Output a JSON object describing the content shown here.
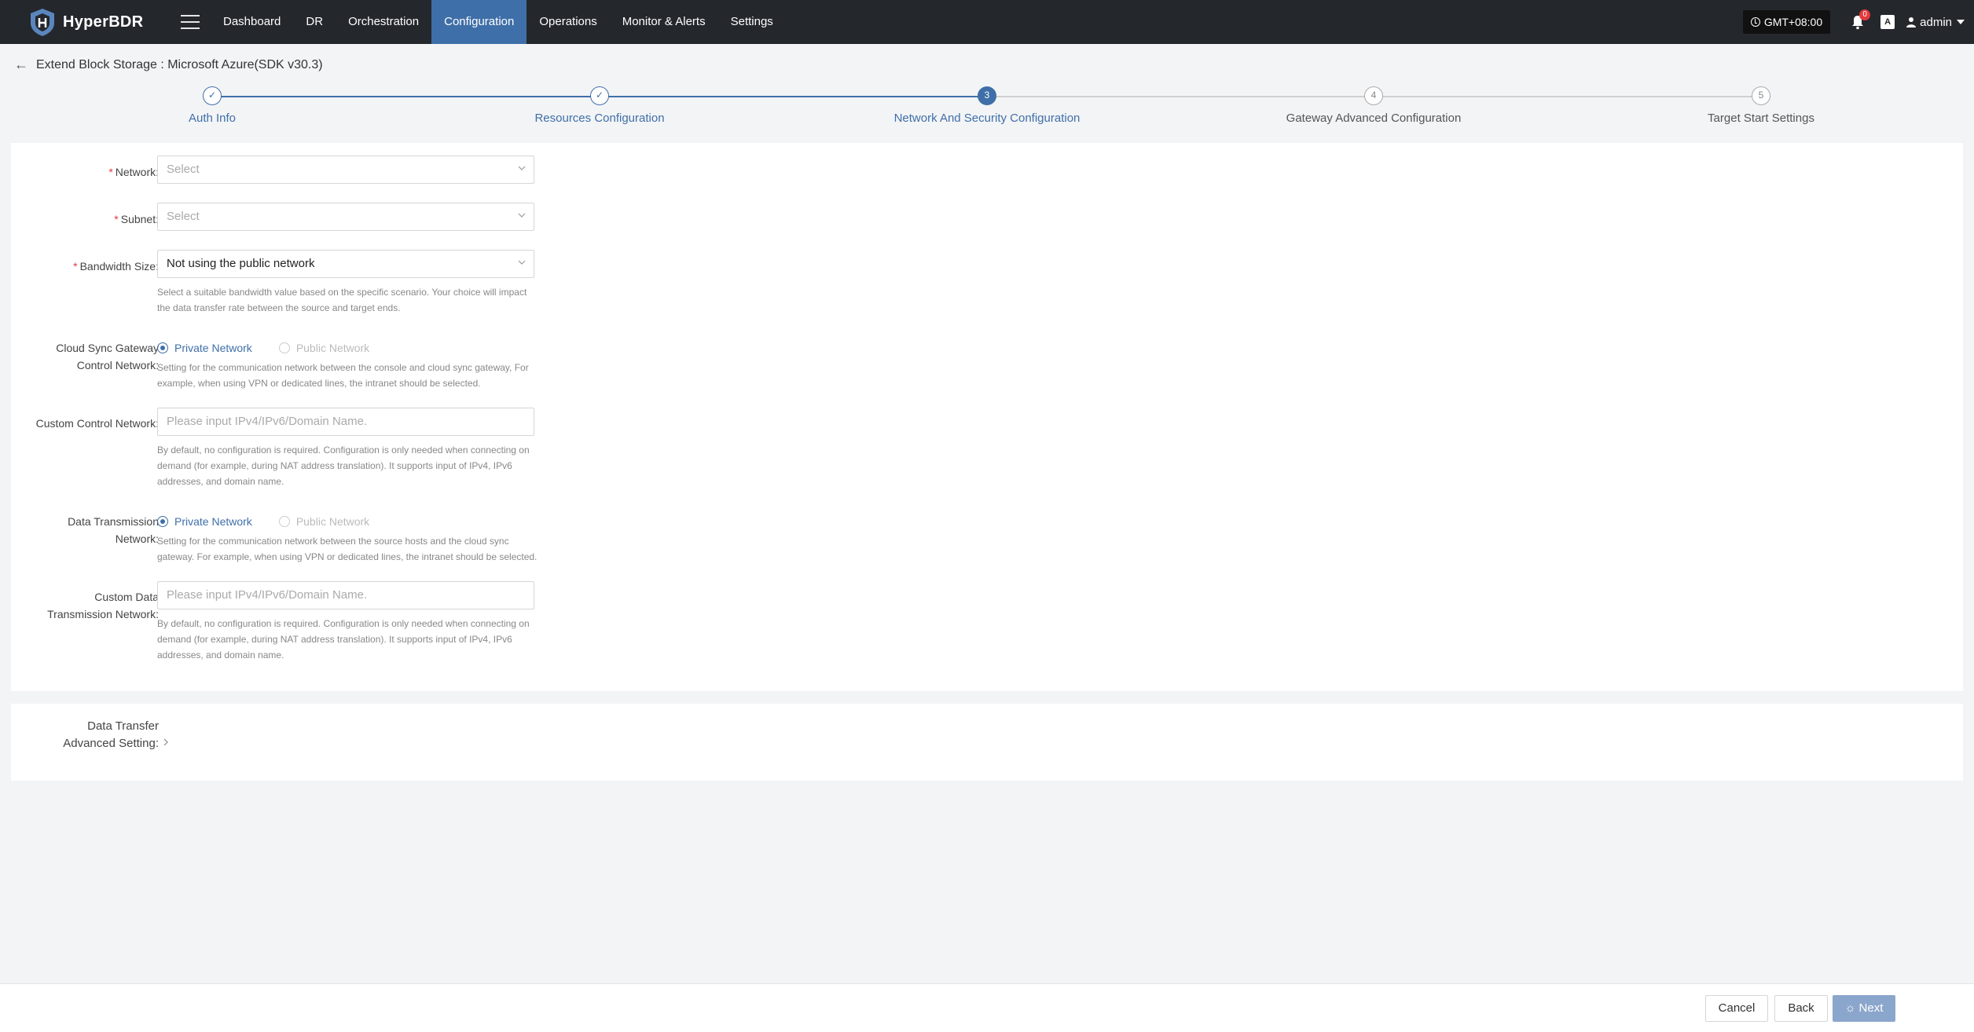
{
  "app": {
    "name": "HyperBDR"
  },
  "nav": {
    "items": [
      "Dashboard",
      "DR",
      "Orchestration",
      "Configuration",
      "Operations",
      "Monitor & Alerts",
      "Settings"
    ],
    "active": "Configuration"
  },
  "topright": {
    "timezone": "GMT+08:00",
    "notifications": "0",
    "lang": "A",
    "user": "admin"
  },
  "page": {
    "title": "Extend Block Storage : Microsoft Azure(SDK v30.3)"
  },
  "steps": [
    {
      "num": "1",
      "label": "Auth Info",
      "state": "done"
    },
    {
      "num": "2",
      "label": "Resources Configuration",
      "state": "done"
    },
    {
      "num": "3",
      "label": "Network And Security Configuration",
      "state": "active"
    },
    {
      "num": "4",
      "label": "Gateway Advanced Configuration",
      "state": "pending"
    },
    {
      "num": "5",
      "label": "Target Start Settings",
      "state": "pending"
    }
  ],
  "form": {
    "network": {
      "label": "Network:",
      "placeholder": "Select"
    },
    "subnet": {
      "label": "Subnet:",
      "placeholder": "Select"
    },
    "bandwidth": {
      "label": "Bandwidth Size:",
      "value": "Not using the public network",
      "help1": "Select a suitable bandwidth value based on the specific scenario. Your choice will impact",
      "help2": "the data transfer rate between the source and target ends."
    },
    "control_network": {
      "label1": "Cloud Sync Gateway",
      "label2": "Control Network:",
      "option_private": "Private Network",
      "option_public": "Public Network",
      "help1": "Setting for the communication network between the console and cloud sync gateway, For",
      "help2": "example, when using VPN or dedicated lines, the intranet should be selected."
    },
    "custom_control": {
      "label": "Custom Control Network:",
      "placeholder": "Please input IPv4/IPv6/Domain Name.",
      "help1": "By default, no configuration is required. Configuration is only needed when connecting on",
      "help2": "demand (for example, during NAT address translation). It supports input of IPv4, IPv6",
      "help3": "addresses, and domain name."
    },
    "data_network": {
      "label1": "Data Transmission",
      "label2": "Network:",
      "option_private": "Private Network",
      "option_public": "Public Network",
      "help1": "Setting for the communication network between the source hosts and the cloud sync",
      "help2": "gateway. For example, when using VPN or dedicated lines, the intranet should be selected."
    },
    "custom_data": {
      "label1": "Custom Data",
      "label2": "Transmission Network:",
      "placeholder": "Please input IPv4/IPv6/Domain Name.",
      "help1": "By default, no configuration is required. Configuration is only needed when connecting on",
      "help2": "demand (for example, during NAT address translation). It supports input of IPv4, IPv6",
      "help3": "addresses, and domain name."
    }
  },
  "advanced": {
    "label1": "Data Transfer",
    "label2": "Advanced Setting:"
  },
  "footer": {
    "cancel": "Cancel",
    "back": "Back",
    "next": "Next"
  },
  "colors": {
    "primary": "#3f6fa8",
    "topbar": "#24272c",
    "required": "#e4393c"
  }
}
